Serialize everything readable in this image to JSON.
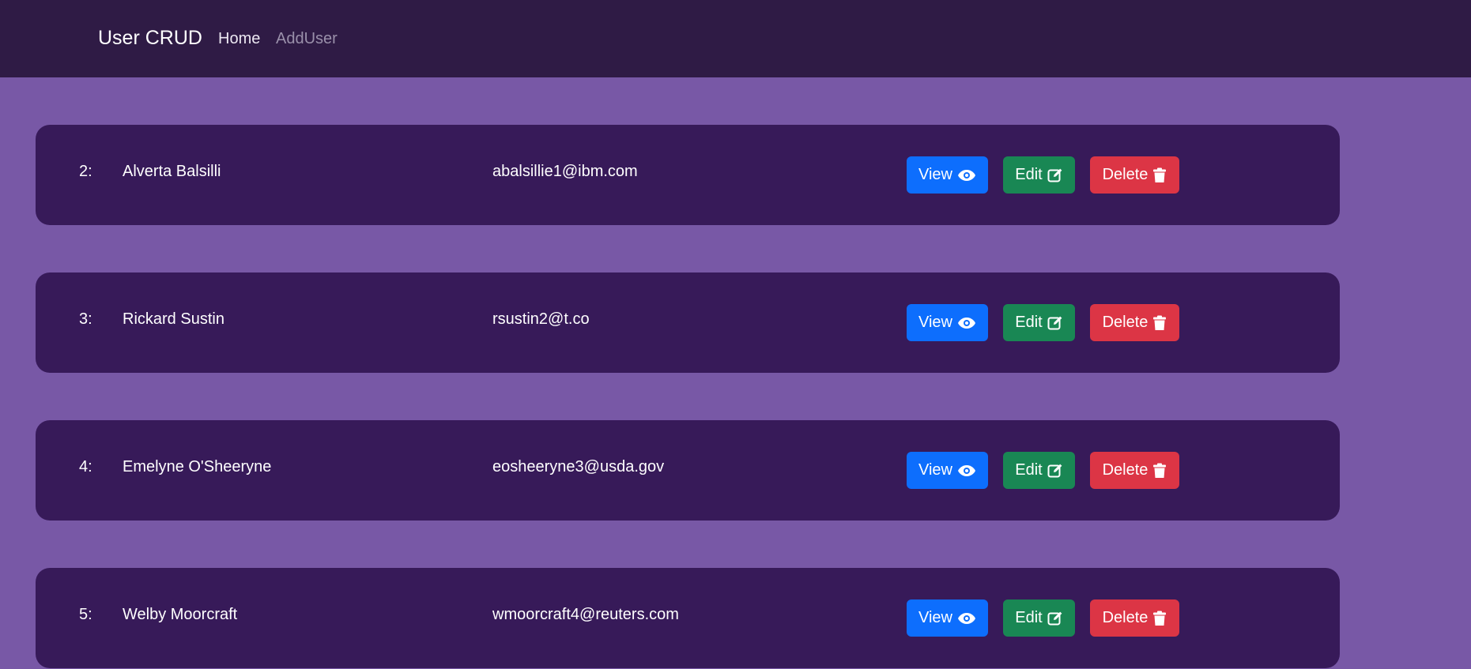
{
  "navbar": {
    "brand": "User CRUD",
    "links": [
      {
        "label": "Home"
      },
      {
        "label": "AddUser"
      }
    ]
  },
  "buttons": {
    "view_label": "View",
    "edit_label": "Edit",
    "delete_label": "Delete",
    "view_icon": "eye-icon",
    "edit_icon": "edit-icon",
    "delete_icon": "trash-icon"
  },
  "colors": {
    "page_background": "#7858a6",
    "navbar_background": "#2f1b45",
    "card_background": "#371a59",
    "view_button": "#0d6efd",
    "edit_button": "#198754",
    "delete_button": "#dc3545"
  },
  "users": [
    {
      "number": "2:",
      "name": "Alverta Balsilli",
      "email": "abalsillie1@ibm.com"
    },
    {
      "number": "3:",
      "name": "Rickard Sustin",
      "email": "rsustin2@t.co"
    },
    {
      "number": "4:",
      "name": "Emelyne O'Sheeryne",
      "email": "eosheeryne3@usda.gov"
    },
    {
      "number": "5:",
      "name": "Welby Moorcraft",
      "email": "wmoorcraft4@reuters.com"
    }
  ]
}
